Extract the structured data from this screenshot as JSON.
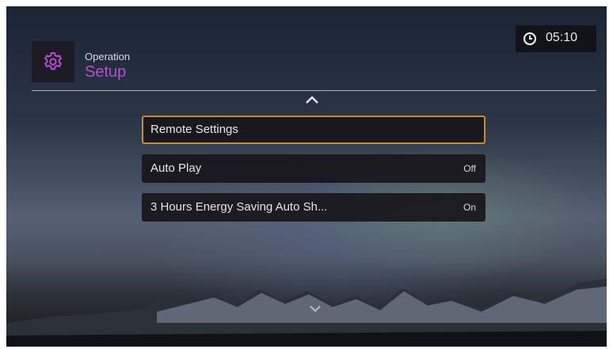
{
  "header": {
    "icon": "gear-icon",
    "subtitle": "Operation",
    "title": "Setup",
    "accent_color": "#b94cd6"
  },
  "clock": {
    "icon": "clock-icon",
    "time": "05:10"
  },
  "menu": {
    "items": [
      {
        "label": "Remote Settings",
        "value": "",
        "focused": true
      },
      {
        "label": "Auto Play",
        "value": "Off",
        "focused": false
      },
      {
        "label": "3 Hours Energy Saving Auto Sh...",
        "value": "On",
        "focused": false
      }
    ],
    "focus_color": "#c98a2b",
    "scroll_up_icon": "chevron-up-icon",
    "scroll_down_icon": "chevron-down-icon"
  }
}
